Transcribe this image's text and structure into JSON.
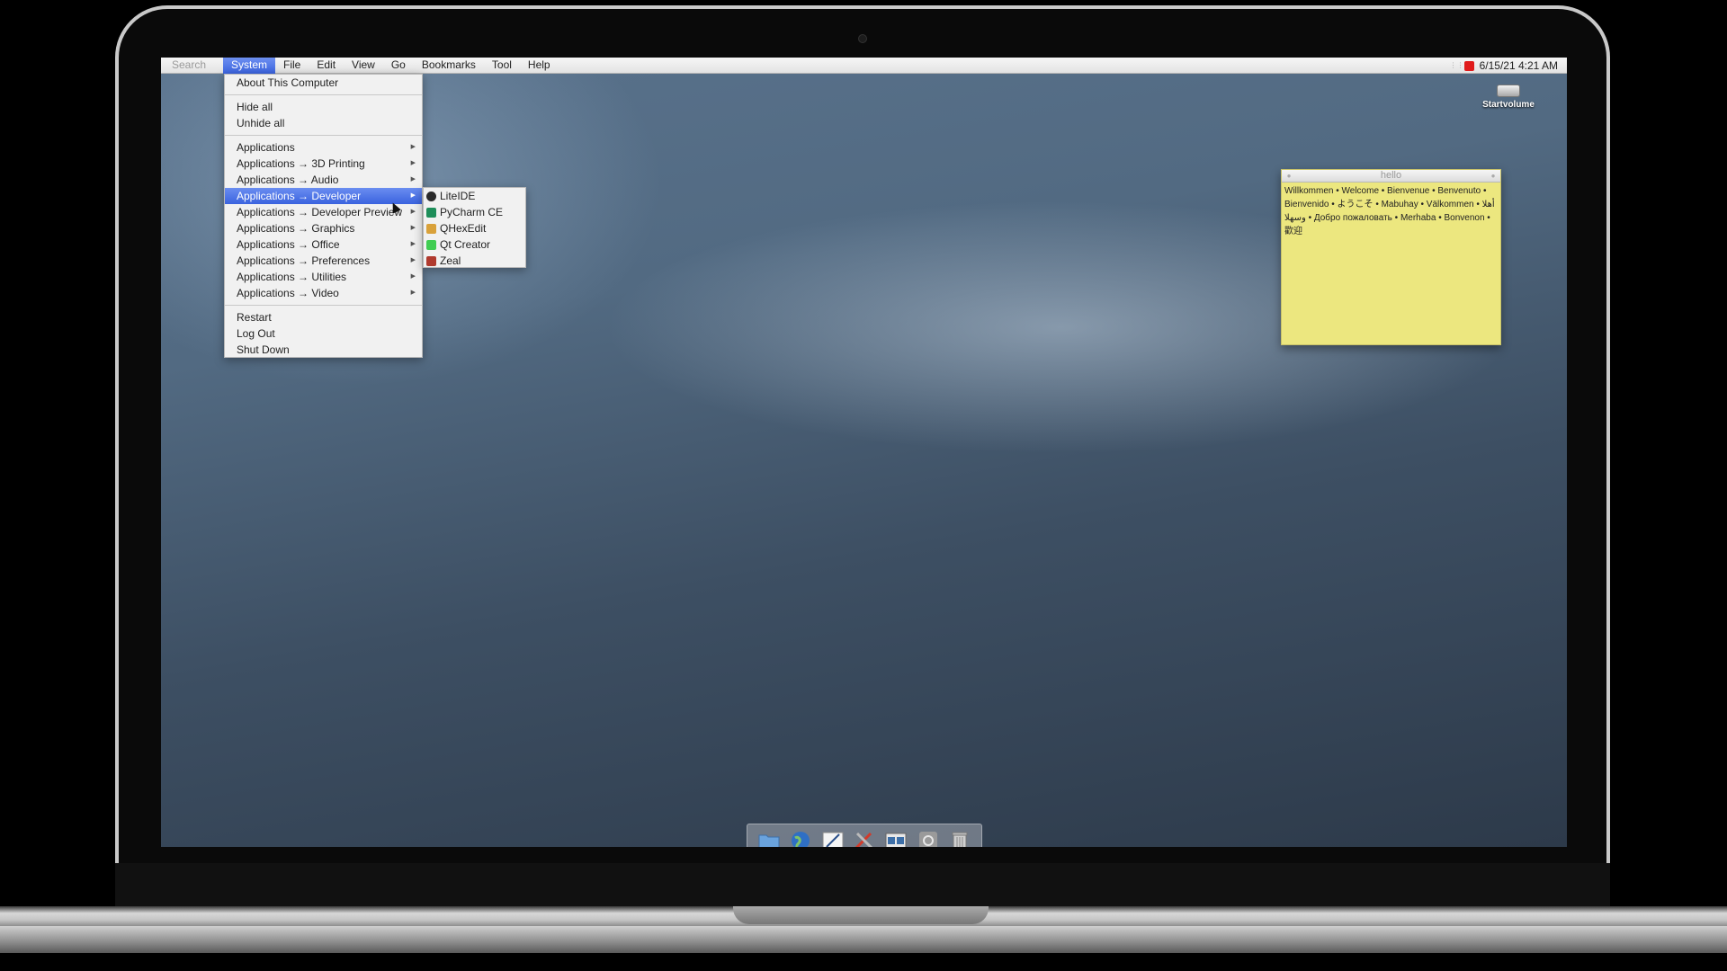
{
  "menubar": {
    "search": "Search",
    "menus": [
      "System",
      "File",
      "Edit",
      "View",
      "Go",
      "Bookmarks",
      "Tool",
      "Help"
    ],
    "clock": "6/15/21 4:21 AM"
  },
  "system_menu": {
    "about": "About This Computer",
    "hide_all": "Hide all",
    "unhide_all": "Unhide all",
    "apps": [
      "Applications",
      "Applications → 3D Printing",
      "Applications → Audio",
      "Applications → Developer",
      "Applications → Developer Preview",
      "Applications → Graphics",
      "Applications → Office",
      "Applications → Preferences",
      "Applications → Utilities",
      "Applications → Video"
    ],
    "restart": "Restart",
    "log_out": "Log Out",
    "shut_down": "Shut Down"
  },
  "developer_submenu": {
    "items": [
      "LiteIDE",
      "PyCharm CE",
      "QHexEdit",
      "Qt Creator",
      "Zeal"
    ],
    "icon_colors": [
      "#2a2a2a",
      "#1e8e5a",
      "#d9a13a",
      "#41cd52",
      "#b03a2e"
    ]
  },
  "desktop": {
    "volume_label": "Startvolume"
  },
  "sticky_note": {
    "title": "hello",
    "text": "Willkommen • Welcome • Bienvenue • Benvenuto • Bienvenido • ようこそ • Mabuhay • Välkommen • أهلا وسهلا • Добро пожаловать • Merhaba • Bonvenon • 歡迎"
  },
  "dock": {
    "items": [
      "folder-icon",
      "globe-icon",
      "text-editor-icon",
      "utilities-icon",
      "windows-icon",
      "settings-icon",
      "trash-icon"
    ]
  },
  "colors": {
    "highlight": "#3b64e0",
    "note": "#ece77f",
    "status_red": "#e01b1b"
  }
}
